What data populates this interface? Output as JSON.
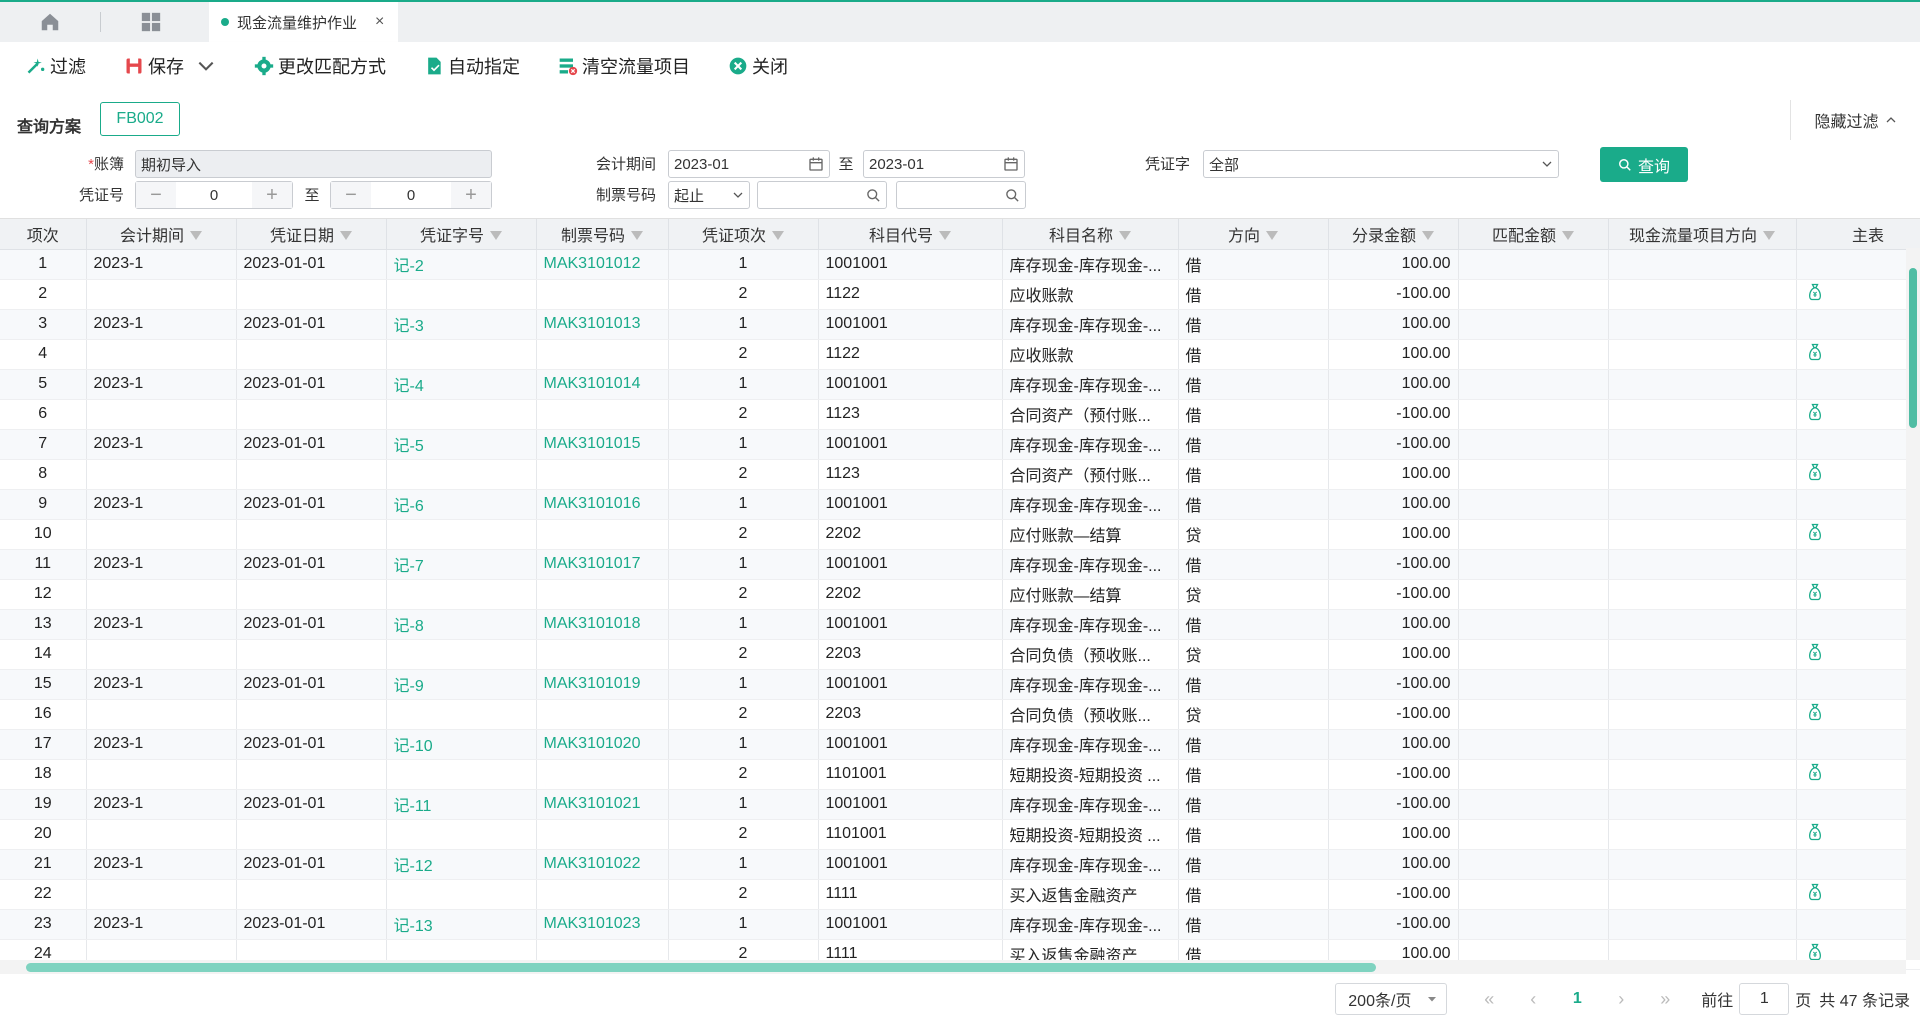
{
  "tabs": {
    "active_label": "现金流量维护作业",
    "close_symbol": "×"
  },
  "toolbar": {
    "filter": "过滤",
    "save": "保存",
    "change_match": "更改匹配方式",
    "auto_assign": "自动指定",
    "clear_items": "清空流量项目",
    "close": "关闭"
  },
  "filter": {
    "scheme_label": "查询方案",
    "scheme_value": "FB002",
    "hide_filter": "隐藏过滤",
    "ledger_label": "账簿",
    "ledger_value": "期初导入",
    "voucher_no_label": "凭证号",
    "voucher_from": "0",
    "voucher_to": "0",
    "to_text": "至",
    "period_label": "会计期间",
    "period_from": "2023-01",
    "period_to": "2023-01",
    "ticket_label": "制票号码",
    "ticket_mode": "起止",
    "voucher_word_label": "凭证字",
    "voucher_word_value": "全部",
    "query_button": "查询"
  },
  "table": {
    "columns": [
      "项次",
      "会计期间",
      "凭证日期",
      "凭证字号",
      "制票号码",
      "凭证项次",
      "科目代号",
      "科目名称",
      "方向",
      "分录金额",
      "匹配金额",
      "现金流量项目方向",
      "主表"
    ],
    "rows": [
      [
        "1",
        "2023-1",
        "2023-01-01",
        "记-2",
        "MAK3101012",
        "1",
        "1001001",
        "库存现金-库存现金-...",
        "借",
        "100.00",
        "",
        "",
        ""
      ],
      [
        "2",
        "",
        "",
        "",
        "",
        "2",
        "1122",
        "应收账款",
        "借",
        "-100.00",
        "",
        "",
        "icon"
      ],
      [
        "3",
        "2023-1",
        "2023-01-01",
        "记-3",
        "MAK3101013",
        "1",
        "1001001",
        "库存现金-库存现金-...",
        "借",
        "100.00",
        "",
        "",
        ""
      ],
      [
        "4",
        "",
        "",
        "",
        "",
        "2",
        "1122",
        "应收账款",
        "借",
        "100.00",
        "",
        "",
        "icon"
      ],
      [
        "5",
        "2023-1",
        "2023-01-01",
        "记-4",
        "MAK3101014",
        "1",
        "1001001",
        "库存现金-库存现金-...",
        "借",
        "100.00",
        "",
        "",
        ""
      ],
      [
        "6",
        "",
        "",
        "",
        "",
        "2",
        "1123",
        "合同资产（预付账...",
        "借",
        "-100.00",
        "",
        "",
        "icon"
      ],
      [
        "7",
        "2023-1",
        "2023-01-01",
        "记-5",
        "MAK3101015",
        "1",
        "1001001",
        "库存现金-库存现金-...",
        "借",
        "-100.00",
        "",
        "",
        ""
      ],
      [
        "8",
        "",
        "",
        "",
        "",
        "2",
        "1123",
        "合同资产（预付账...",
        "借",
        "100.00",
        "",
        "",
        "icon"
      ],
      [
        "9",
        "2023-1",
        "2023-01-01",
        "记-6",
        "MAK3101016",
        "1",
        "1001001",
        "库存现金-库存现金-...",
        "借",
        "100.00",
        "",
        "",
        ""
      ],
      [
        "10",
        "",
        "",
        "",
        "",
        "2",
        "2202",
        "应付账款—结算",
        "贷",
        "100.00",
        "",
        "",
        "icon"
      ],
      [
        "11",
        "2023-1",
        "2023-01-01",
        "记-7",
        "MAK3101017",
        "1",
        "1001001",
        "库存现金-库存现金-...",
        "借",
        "-100.00",
        "",
        "",
        ""
      ],
      [
        "12",
        "",
        "",
        "",
        "",
        "2",
        "2202",
        "应付账款—结算",
        "贷",
        "-100.00",
        "",
        "",
        "icon"
      ],
      [
        "13",
        "2023-1",
        "2023-01-01",
        "记-8",
        "MAK3101018",
        "1",
        "1001001",
        "库存现金-库存现金-...",
        "借",
        "100.00",
        "",
        "",
        ""
      ],
      [
        "14",
        "",
        "",
        "",
        "",
        "2",
        "2203",
        "合同负债（预收账...",
        "贷",
        "100.00",
        "",
        "",
        "icon"
      ],
      [
        "15",
        "2023-1",
        "2023-01-01",
        "记-9",
        "MAK3101019",
        "1",
        "1001001",
        "库存现金-库存现金-...",
        "借",
        "-100.00",
        "",
        "",
        ""
      ],
      [
        "16",
        "",
        "",
        "",
        "",
        "2",
        "2203",
        "合同负债（预收账...",
        "贷",
        "-100.00",
        "",
        "",
        "icon"
      ],
      [
        "17",
        "2023-1",
        "2023-01-01",
        "记-10",
        "MAK3101020",
        "1",
        "1001001",
        "库存现金-库存现金-...",
        "借",
        "100.00",
        "",
        "",
        ""
      ],
      [
        "18",
        "",
        "",
        "",
        "",
        "2",
        "1101001",
        "短期投资-短期投资 ...",
        "借",
        "-100.00",
        "",
        "",
        "icon"
      ],
      [
        "19",
        "2023-1",
        "2023-01-01",
        "记-11",
        "MAK3101021",
        "1",
        "1001001",
        "库存现金-库存现金-...",
        "借",
        "-100.00",
        "",
        "",
        ""
      ],
      [
        "20",
        "",
        "",
        "",
        "",
        "2",
        "1101001",
        "短期投资-短期投资 ...",
        "借",
        "100.00",
        "",
        "",
        "icon"
      ],
      [
        "21",
        "2023-1",
        "2023-01-01",
        "记-12",
        "MAK3101022",
        "1",
        "1001001",
        "库存现金-库存现金-...",
        "借",
        "100.00",
        "",
        "",
        ""
      ],
      [
        "22",
        "",
        "",
        "",
        "",
        "2",
        "1111",
        "买入返售金融资产",
        "借",
        "-100.00",
        "",
        "",
        "icon"
      ],
      [
        "23",
        "2023-1",
        "2023-01-01",
        "记-13",
        "MAK3101023",
        "1",
        "1001001",
        "库存现金-库存现金-...",
        "借",
        "-100.00",
        "",
        "",
        ""
      ],
      [
        "24",
        "",
        "",
        "",
        "",
        "2",
        "1111",
        "买入返售金融资产",
        "借",
        "100.00",
        "",
        "",
        "icon"
      ]
    ]
  },
  "pager": {
    "page_size": "200条/页",
    "current_page": "1",
    "goto_label": "前往",
    "goto_value": "1",
    "page_unit": "页",
    "total": "共 47 条记录"
  },
  "colors": {
    "accent": "#1aab8a",
    "header_bg": "#f0f2f4"
  }
}
